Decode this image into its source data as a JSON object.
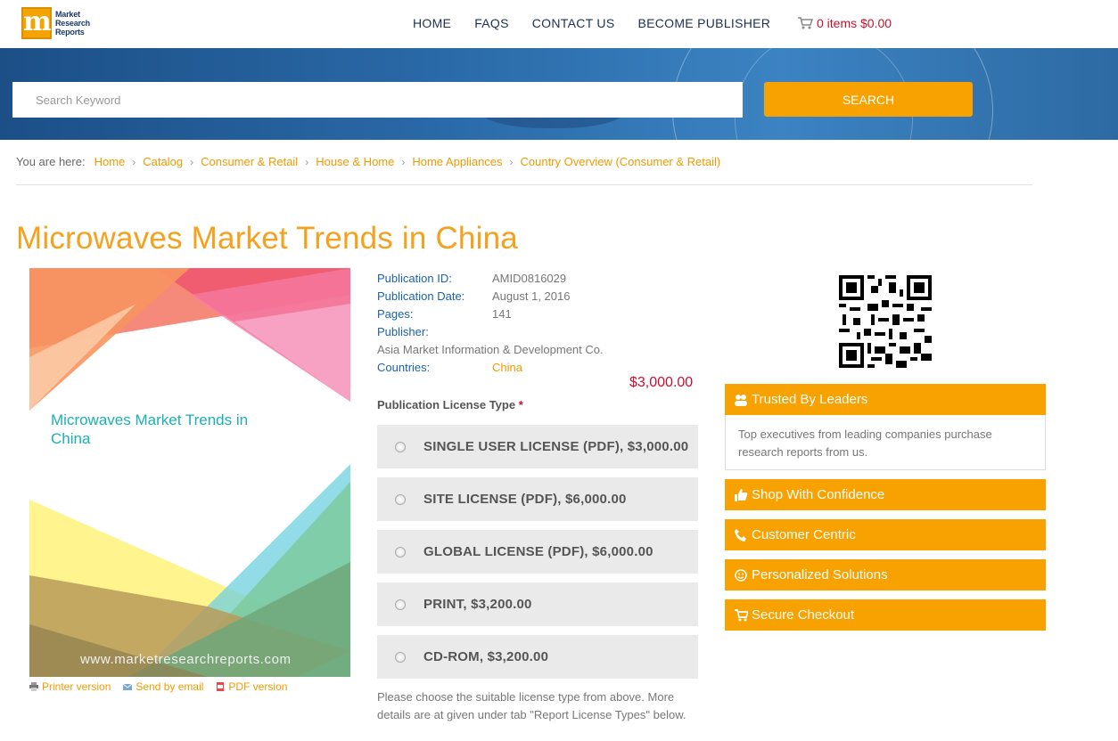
{
  "header": {
    "logo_lines": [
      "Market",
      "Research",
      "Reports"
    ],
    "nav": [
      "HOME",
      "FAQS",
      "CONTACT US",
      "BECOME PUBLISHER"
    ],
    "cart": "0 items $0.00"
  },
  "search": {
    "placeholder": "Search Keyword",
    "button": "SEARCH"
  },
  "breadcrumb": {
    "lead": "You are here:",
    "items": [
      "Home",
      "Catalog",
      "Consumer & Retail",
      "House & Home",
      "Home Appliances",
      "Country Overview (Consumer & Retail)"
    ]
  },
  "title": "Microwaves Market Trends in China",
  "cover": {
    "title": "Microwaves Market Trends in China",
    "url": "www.marketresearchreports.com"
  },
  "cover_links": [
    "Printer version",
    "Send by email",
    "PDF version"
  ],
  "details": {
    "publication_id_label": "Publication ID:",
    "publication_id": "AMID0816029",
    "publication_date_label": "Publication Date:",
    "publication_date": "August 1, 2016",
    "pages_label": "Pages:",
    "pages": "141",
    "publisher_label": "Publisher:",
    "publisher": "Asia Market Information & Development Co.",
    "countries_label": "Countries:",
    "countries": "China"
  },
  "price": "$3,000.00",
  "license": {
    "heading": "Publication License Type",
    "required_mark": "*",
    "options": [
      "SINGLE USER LICENSE (PDF), $3,000.00",
      "SITE LICENSE (PDF), $6,000.00",
      "GLOBAL LICENSE (PDF), $6,000.00",
      "PRINT, $3,200.00",
      "CD-ROM, $3,200.00"
    ],
    "note": "Please choose the suitable license type from above. More details are at given under tab \"Report License Types\" below."
  },
  "sidebar": {
    "panels": [
      {
        "label": "Trusted By Leaders",
        "icon": "users-icon"
      },
      {
        "label": "Shop With Confidence",
        "icon": "thumbs-up-icon"
      },
      {
        "label": "Customer Centric",
        "icon": "phone-icon"
      },
      {
        "label": "Personalized Solutions",
        "icon": "smile-icon"
      },
      {
        "label": "Secure Checkout",
        "icon": "cart-icon"
      }
    ],
    "trusted_body": "Top executives from leading companies purchase research reports from us."
  },
  "colors": {
    "accent": "#f7a200",
    "link": "#f29a00",
    "label_blue": "#1a63a8",
    "price_red": "#c8102e",
    "title_orange": "#f4a11d"
  }
}
